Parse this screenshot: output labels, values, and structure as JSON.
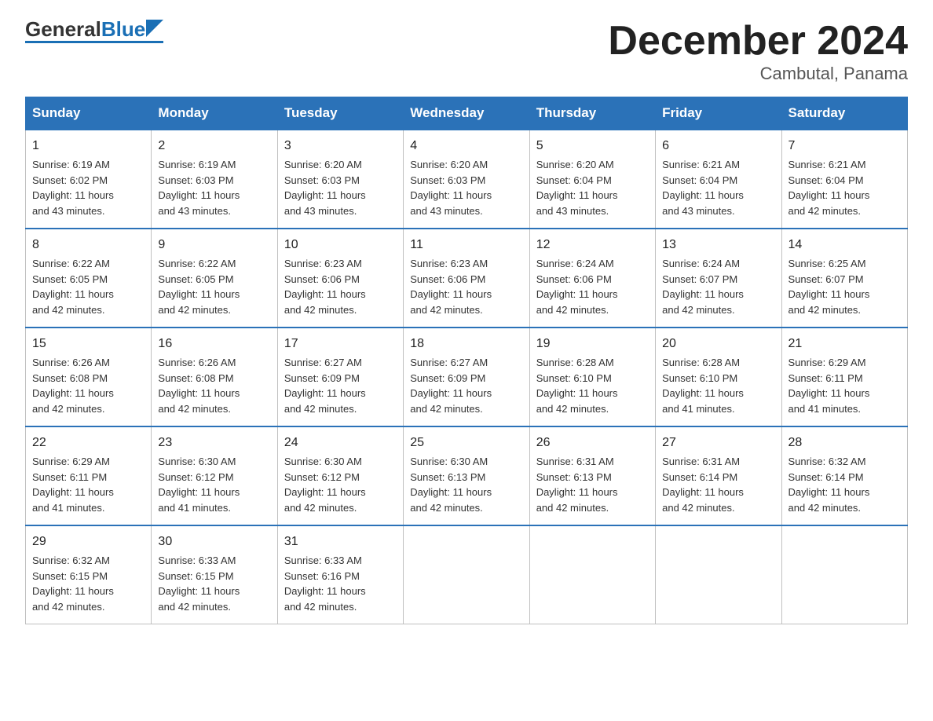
{
  "logo": {
    "general": "General",
    "blue": "Blue"
  },
  "title": "December 2024",
  "subtitle": "Cambutal, Panama",
  "days_of_week": [
    "Sunday",
    "Monday",
    "Tuesday",
    "Wednesday",
    "Thursday",
    "Friday",
    "Saturday"
  ],
  "weeks": [
    [
      {
        "num": "1",
        "info": "Sunrise: 6:19 AM\nSunset: 6:02 PM\nDaylight: 11 hours\nand 43 minutes."
      },
      {
        "num": "2",
        "info": "Sunrise: 6:19 AM\nSunset: 6:03 PM\nDaylight: 11 hours\nand 43 minutes."
      },
      {
        "num": "3",
        "info": "Sunrise: 6:20 AM\nSunset: 6:03 PM\nDaylight: 11 hours\nand 43 minutes."
      },
      {
        "num": "4",
        "info": "Sunrise: 6:20 AM\nSunset: 6:03 PM\nDaylight: 11 hours\nand 43 minutes."
      },
      {
        "num": "5",
        "info": "Sunrise: 6:20 AM\nSunset: 6:04 PM\nDaylight: 11 hours\nand 43 minutes."
      },
      {
        "num": "6",
        "info": "Sunrise: 6:21 AM\nSunset: 6:04 PM\nDaylight: 11 hours\nand 43 minutes."
      },
      {
        "num": "7",
        "info": "Sunrise: 6:21 AM\nSunset: 6:04 PM\nDaylight: 11 hours\nand 42 minutes."
      }
    ],
    [
      {
        "num": "8",
        "info": "Sunrise: 6:22 AM\nSunset: 6:05 PM\nDaylight: 11 hours\nand 42 minutes."
      },
      {
        "num": "9",
        "info": "Sunrise: 6:22 AM\nSunset: 6:05 PM\nDaylight: 11 hours\nand 42 minutes."
      },
      {
        "num": "10",
        "info": "Sunrise: 6:23 AM\nSunset: 6:06 PM\nDaylight: 11 hours\nand 42 minutes."
      },
      {
        "num": "11",
        "info": "Sunrise: 6:23 AM\nSunset: 6:06 PM\nDaylight: 11 hours\nand 42 minutes."
      },
      {
        "num": "12",
        "info": "Sunrise: 6:24 AM\nSunset: 6:06 PM\nDaylight: 11 hours\nand 42 minutes."
      },
      {
        "num": "13",
        "info": "Sunrise: 6:24 AM\nSunset: 6:07 PM\nDaylight: 11 hours\nand 42 minutes."
      },
      {
        "num": "14",
        "info": "Sunrise: 6:25 AM\nSunset: 6:07 PM\nDaylight: 11 hours\nand 42 minutes."
      }
    ],
    [
      {
        "num": "15",
        "info": "Sunrise: 6:26 AM\nSunset: 6:08 PM\nDaylight: 11 hours\nand 42 minutes."
      },
      {
        "num": "16",
        "info": "Sunrise: 6:26 AM\nSunset: 6:08 PM\nDaylight: 11 hours\nand 42 minutes."
      },
      {
        "num": "17",
        "info": "Sunrise: 6:27 AM\nSunset: 6:09 PM\nDaylight: 11 hours\nand 42 minutes."
      },
      {
        "num": "18",
        "info": "Sunrise: 6:27 AM\nSunset: 6:09 PM\nDaylight: 11 hours\nand 42 minutes."
      },
      {
        "num": "19",
        "info": "Sunrise: 6:28 AM\nSunset: 6:10 PM\nDaylight: 11 hours\nand 42 minutes."
      },
      {
        "num": "20",
        "info": "Sunrise: 6:28 AM\nSunset: 6:10 PM\nDaylight: 11 hours\nand 41 minutes."
      },
      {
        "num": "21",
        "info": "Sunrise: 6:29 AM\nSunset: 6:11 PM\nDaylight: 11 hours\nand 41 minutes."
      }
    ],
    [
      {
        "num": "22",
        "info": "Sunrise: 6:29 AM\nSunset: 6:11 PM\nDaylight: 11 hours\nand 41 minutes."
      },
      {
        "num": "23",
        "info": "Sunrise: 6:30 AM\nSunset: 6:12 PM\nDaylight: 11 hours\nand 41 minutes."
      },
      {
        "num": "24",
        "info": "Sunrise: 6:30 AM\nSunset: 6:12 PM\nDaylight: 11 hours\nand 42 minutes."
      },
      {
        "num": "25",
        "info": "Sunrise: 6:30 AM\nSunset: 6:13 PM\nDaylight: 11 hours\nand 42 minutes."
      },
      {
        "num": "26",
        "info": "Sunrise: 6:31 AM\nSunset: 6:13 PM\nDaylight: 11 hours\nand 42 minutes."
      },
      {
        "num": "27",
        "info": "Sunrise: 6:31 AM\nSunset: 6:14 PM\nDaylight: 11 hours\nand 42 minutes."
      },
      {
        "num": "28",
        "info": "Sunrise: 6:32 AM\nSunset: 6:14 PM\nDaylight: 11 hours\nand 42 minutes."
      }
    ],
    [
      {
        "num": "29",
        "info": "Sunrise: 6:32 AM\nSunset: 6:15 PM\nDaylight: 11 hours\nand 42 minutes."
      },
      {
        "num": "30",
        "info": "Sunrise: 6:33 AM\nSunset: 6:15 PM\nDaylight: 11 hours\nand 42 minutes."
      },
      {
        "num": "31",
        "info": "Sunrise: 6:33 AM\nSunset: 6:16 PM\nDaylight: 11 hours\nand 42 minutes."
      },
      {
        "num": "",
        "info": ""
      },
      {
        "num": "",
        "info": ""
      },
      {
        "num": "",
        "info": ""
      },
      {
        "num": "",
        "info": ""
      }
    ]
  ]
}
